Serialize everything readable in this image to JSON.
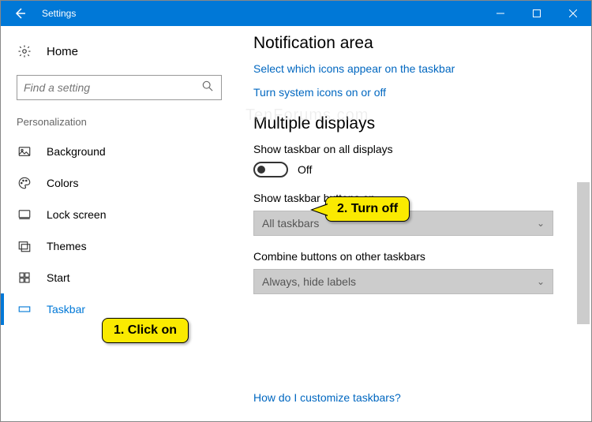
{
  "window": {
    "title": "Settings"
  },
  "sidebar": {
    "home_label": "Home",
    "search_placeholder": "Find a setting",
    "section_label": "Personalization",
    "items": [
      {
        "label": "Background"
      },
      {
        "label": "Colors"
      },
      {
        "label": "Lock screen"
      },
      {
        "label": "Themes"
      },
      {
        "label": "Start"
      },
      {
        "label": "Taskbar"
      }
    ]
  },
  "main": {
    "heading1": "Notification area",
    "link1": "Select which icons appear on the taskbar",
    "link2": "Turn system icons on or off",
    "heading2": "Multiple displays",
    "setting1_label": "Show taskbar on all displays",
    "setting1_state": "Off",
    "setting2_label": "Show taskbar buttons on",
    "setting2_value": "All taskbars",
    "setting3_label": "Combine buttons on other taskbars",
    "setting3_value": "Always, hide labels",
    "help_link": "How do I customize taskbars?"
  },
  "annotations": {
    "callout1": "1. Click on",
    "callout2": "2. Turn off"
  },
  "watermark": "TenForums.com"
}
